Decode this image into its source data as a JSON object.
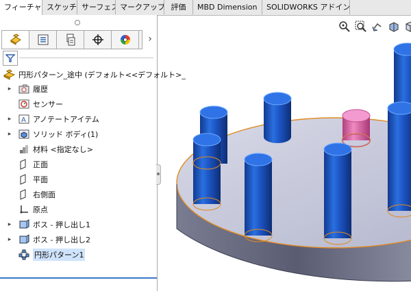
{
  "command_tabs": [
    {
      "label": "フィーチャー",
      "active": true
    },
    {
      "label": "スケッチ"
    },
    {
      "label": "サーフェス"
    },
    {
      "label": "マークアップ"
    },
    {
      "label": "評価"
    },
    {
      "label": "MBD Dimension"
    },
    {
      "label": "SOLIDWORKS アドイン"
    }
  ],
  "manager_tabs": [
    {
      "icon": "feature-manager-icon"
    },
    {
      "icon": "property-manager-icon"
    },
    {
      "icon": "configuration-manager-icon"
    },
    {
      "icon": "dimxpert-manager-icon"
    },
    {
      "icon": "display-manager-icon"
    }
  ],
  "tree": {
    "root_label": "円形パターン_途中 (デフォルト<<デフォルト>_",
    "items": [
      {
        "label": "履歴",
        "icon": "history-folder-icon",
        "expandable": true
      },
      {
        "label": "センサー",
        "icon": "sensor-icon",
        "expandable": false
      },
      {
        "label": "アノテートアイテム",
        "icon": "annotations-icon",
        "expandable": true
      },
      {
        "label": "ソリッド ボディ(1)",
        "icon": "solid-bodies-icon",
        "expandable": true
      },
      {
        "label": "材料 <指定なし>",
        "icon": "material-icon",
        "expandable": false
      },
      {
        "label": "正面",
        "icon": "plane-icon",
        "expandable": false
      },
      {
        "label": "平面",
        "icon": "plane-icon",
        "expandable": false
      },
      {
        "label": "右側面",
        "icon": "plane-icon",
        "expandable": false
      },
      {
        "label": "原点",
        "icon": "origin-icon",
        "expandable": false
      },
      {
        "label": "ボス - 押し出し1",
        "icon": "boss-extrude-icon",
        "expandable": true
      },
      {
        "label": "ボス - 押し出し2",
        "icon": "boss-extrude-icon",
        "expandable": true
      },
      {
        "label": "円形パターン1",
        "icon": "circular-pattern-icon",
        "expandable": false,
        "selected": true
      }
    ]
  },
  "heads_up_toolbar": [
    "zoom-to-fit-icon",
    "zoom-to-area-icon",
    "previous-view-icon",
    "section-view-icon",
    "view-orientation-icon"
  ],
  "colors": {
    "pin_blue": "#1d58c8",
    "pin_highlight_pink": "#e070b0",
    "base_top": "#c9cbe0",
    "base_side": "#5d5f76",
    "edge_orange": "#e08a20"
  }
}
